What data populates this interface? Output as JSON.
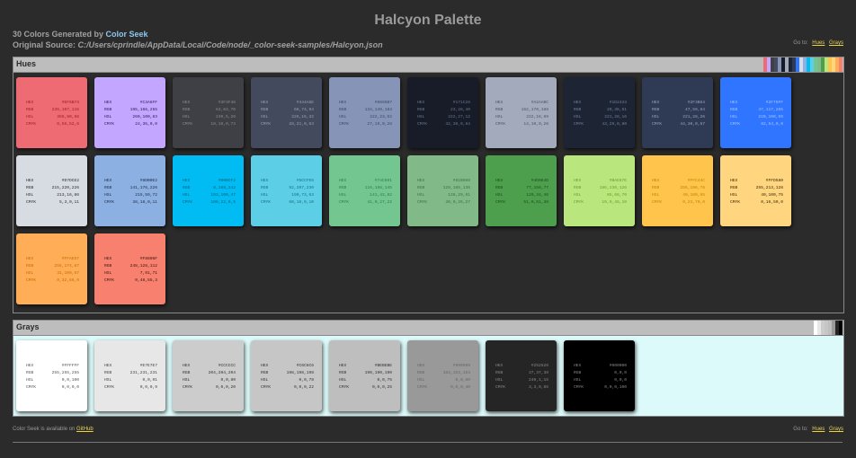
{
  "page": {
    "title": "Halcyon Palette",
    "count_text": "30 Colors Generated by ",
    "brand_link": "Color Seek",
    "source_label": "Original Source: ",
    "source_path": "C:/Users/cprindle/AppData/Local/Code/node/_color-seek-samples/Halcyon.json",
    "goto_label": "Go to:",
    "goto_hues": "Hues",
    "goto_grays": "Grays"
  },
  "labels": {
    "hex": "HEX",
    "rgb": "RGB",
    "hsl": "HSL",
    "cmyk": "CMYK"
  },
  "hues": {
    "title": "Hues",
    "colors": [
      {
        "hex": "#EF6B73",
        "rgb": "239,107,115",
        "hsl": "356,80,68",
        "cmyk": "0,55,52,6",
        "bg": "#EF6B73",
        "fg": "#9e1a26"
      },
      {
        "hex": "#C3A6FF",
        "rgb": "195,166,255",
        "hsl": "260,100,83",
        "cmyk": "24,35,0,0",
        "bg": "#C3A6FF",
        "fg": "#2b1a55"
      },
      {
        "hex": "#3F3F46",
        "rgb": "63,63,70",
        "hsl": "240,5,26",
        "cmyk": "10,10,0,73",
        "bg": "#3F3F46",
        "fg": "#8c8c96"
      },
      {
        "hex": "#444A5E",
        "rgb": "68,74,94",
        "hsl": "226,16,32",
        "cmyk": "28,21,0,63",
        "bg": "#444A5E",
        "fg": "#9aa0b4"
      },
      {
        "hex": "#8695B7",
        "rgb": "134,149,183",
        "hsl": "222,23,62",
        "cmyk": "27,19,0,28",
        "bg": "#8695B7",
        "fg": "#3a4766"
      },
      {
        "hex": "#171C28",
        "rgb": "23,28,40",
        "hsl": "222,27,12",
        "cmyk": "42,30,0,84",
        "bg": "#171C28",
        "fg": "#6b7894"
      },
      {
        "hex": "#A2AABC",
        "rgb": "162,170,188",
        "hsl": "222,16,69",
        "cmyk": "14,10,0,26",
        "bg": "#A2AABC",
        "fg": "#4a5266"
      },
      {
        "hex": "#1D2433",
        "rgb": "29,36,51",
        "hsl": "221,28,16",
        "cmyk": "43,29,0,80",
        "bg": "#1D2433",
        "fg": "#7180a0"
      },
      {
        "hex": "#2F3B54",
        "rgb": "47,59,84",
        "hsl": "221,28,26",
        "cmyk": "44,30,0,67",
        "bg": "#2F3B54",
        "fg": "#94a4c4"
      },
      {
        "hex": "#2F75FF",
        "rgb": "47,117,255",
        "hsl": "220,100,59",
        "cmyk": "82,54,0,0",
        "bg": "#2F75FF",
        "fg": "#a8c6ff"
      },
      {
        "hex": "#D7DCE2",
        "rgb": "215,220,226",
        "hsl": "213,16,86",
        "cmyk": "5,3,0,11",
        "bg": "#D7DCE2",
        "fg": "#2b2b2b"
      },
      {
        "hex": "#8DB0E2",
        "rgb": "141,176,226",
        "hsl": "215,59,72",
        "cmyk": "38,18,0,11",
        "bg": "#8DB0E2",
        "fg": "#1c2b44"
      },
      {
        "hex": "#00BCF2",
        "rgb": "0,188,242",
        "hsl": "193,100,47",
        "cmyk": "100,22,0,5",
        "bg": "#00BCF2",
        "fg": "#006080"
      },
      {
        "hex": "#5CCFE6",
        "rgb": "92,207,230",
        "hsl": "190,73,63",
        "cmyk": "60,10,0,10",
        "bg": "#5CCFE6",
        "fg": "#1a6f80"
      },
      {
        "hex": "#74C691",
        "rgb": "116,198,145",
        "hsl": "141,42,62",
        "cmyk": "41,0,27,22",
        "bg": "#74C691",
        "fg": "#2f7a4a"
      },
      {
        "hex": "#81B988",
        "rgb": "129,185,136",
        "hsl": "128,29,61",
        "cmyk": "30,0,26,27",
        "bg": "#81B988",
        "fg": "#3b7244"
      },
      {
        "hex": "#4D9E4D",
        "rgb": "77,158,77",
        "hsl": "120,34,46",
        "cmyk": "51,0,51,38",
        "bg": "#4D9E4D",
        "fg": "#1b4f1b"
      },
      {
        "hex": "#BAE67E",
        "rgb": "186,230,126",
        "hsl": "85,68,70",
        "cmyk": "19,0,45,10",
        "bg": "#BAE67E",
        "fg": "#6e9d2b"
      },
      {
        "hex": "#FFC44C",
        "rgb": "255,196,76",
        "hsl": "40,100,65",
        "cmyk": "0,23,70,0",
        "bg": "#FFC44C",
        "fg": "#c48000"
      },
      {
        "hex": "#FFD580",
        "rgb": "255,213,128",
        "hsl": "40,100,75",
        "cmyk": "0,16,50,0",
        "bg": "#FFD580",
        "fg": "#3a2a00"
      },
      {
        "hex": "#FFAE57",
        "rgb": "255,174,87",
        "hsl": "31,100,67",
        "cmyk": "0,32,66,0",
        "bg": "#FFAE57",
        "fg": "#c86a00"
      },
      {
        "hex": "#F8806F",
        "rgb": "248,128,112",
        "hsl": "7,91,71",
        "cmyk": "0,48,55,3",
        "bg": "#F8806F",
        "fg": "#3a1410"
      }
    ]
  },
  "grays": {
    "title": "Grays",
    "colors": [
      {
        "hex": "#FFFFFF",
        "rgb": "255,255,255",
        "hsl": "0,0,100",
        "cmyk": "0,0,0,0",
        "bg": "#FFFFFF",
        "fg": "#555555"
      },
      {
        "hex": "#E7E7E7",
        "rgb": "231,231,231",
        "hsl": "0,0,91",
        "cmyk": "0,0,0,9",
        "bg": "#E7E7E7",
        "fg": "#444444"
      },
      {
        "hex": "#CCCCCC",
        "rgb": "204,204,204",
        "hsl": "0,0,80",
        "cmyk": "0,0,0,20",
        "bg": "#CCCCCC",
        "fg": "#333333"
      },
      {
        "hex": "#C6C6C6",
        "rgb": "198,198,198",
        "hsl": "0,0,78",
        "cmyk": "0,0,0,22",
        "bg": "#C6C6C6",
        "fg": "#333333"
      },
      {
        "hex": "#BEBEBE",
        "rgb": "190,190,190",
        "hsl": "0,0,75",
        "cmyk": "0,0,0,25",
        "bg": "#BEBEBE",
        "fg": "#333333"
      },
      {
        "hex": "#999999",
        "rgb": "153,153,153",
        "hsl": "0,0,60",
        "cmyk": "0,0,0,40",
        "bg": "#999999",
        "fg": "#666666"
      },
      {
        "hex": "#252526",
        "rgb": "37,37,38",
        "hsl": "240,1,15",
        "cmyk": "3,3,0,85",
        "bg": "#252526",
        "fg": "#888888"
      },
      {
        "hex": "#000000",
        "rgb": "0,0,0",
        "hsl": "0,0,0",
        "cmyk": "0,0,0,100",
        "bg": "#000000",
        "fg": "#888888"
      }
    ]
  },
  "strips": {
    "hues": [
      "#EF6B73",
      "#C3A6FF",
      "#3F3F46",
      "#444A5E",
      "#8695B7",
      "#171C28",
      "#A2AABC",
      "#1D2433",
      "#2F3B54",
      "#2F75FF",
      "#D7DCE2",
      "#8DB0E2",
      "#00BCF2",
      "#5CCFE6",
      "#74C691",
      "#81B988",
      "#4D9E4D",
      "#BAE67E",
      "#FFC44C",
      "#FFD580",
      "#FFAE57",
      "#F8806F"
    ],
    "grays": [
      "#FFFFFF",
      "#E7E7E7",
      "#CCCCCC",
      "#C6C6C6",
      "#BEBEBE",
      "#999999",
      "#252526",
      "#000000"
    ]
  },
  "footer": {
    "text": "Color Seek is available on ",
    "link": "GitHub"
  }
}
